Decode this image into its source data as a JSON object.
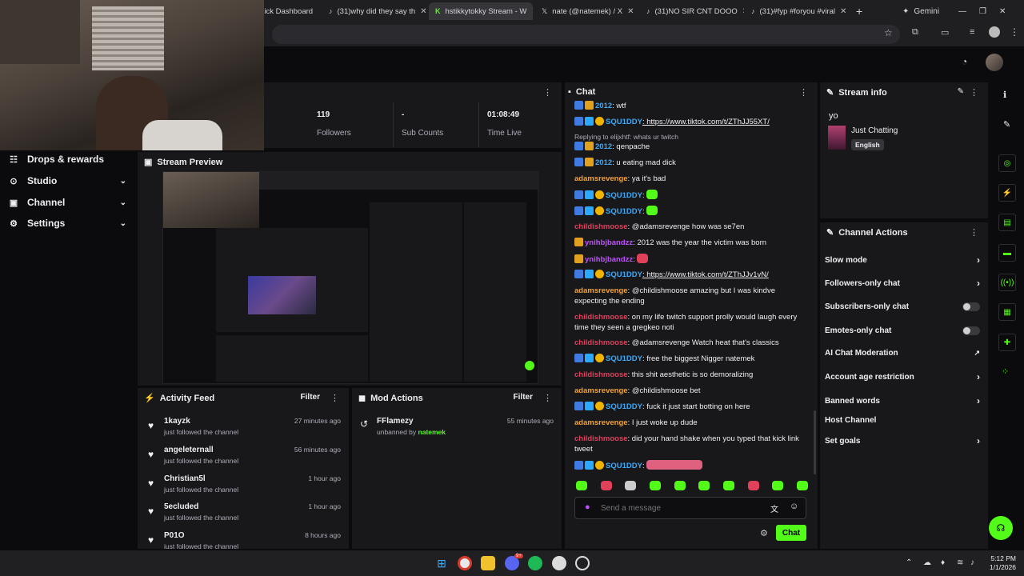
{
  "browser": {
    "tabs": [
      {
        "label": "Kick Dashboard",
        "icon": "kick-icon"
      },
      {
        "label": "(31)why did they say th",
        "icon": "tiktok-icon"
      },
      {
        "label": "hstikkytokky Stream - W",
        "icon": "kick-icon"
      },
      {
        "label": "nate (@natemek) / X",
        "icon": "x-icon"
      },
      {
        "label": "(31)NO SIR CNT DOOO",
        "icon": "tiktok-icon"
      },
      {
        "label": "(31)#fyp #foryou #viral",
        "icon": "tiktok-icon"
      }
    ],
    "gemini_label": "Gemini"
  },
  "sidebar": {
    "items": [
      {
        "label": "Drops & rewards",
        "icon": "rewards-icon"
      },
      {
        "label": "Studio",
        "icon": "studio-icon"
      },
      {
        "label": "Channel",
        "icon": "channel-icon"
      },
      {
        "label": "Settings",
        "icon": "gear-icon"
      }
    ]
  },
  "stats": {
    "followers": {
      "value": "119",
      "label": "Followers"
    },
    "subs": {
      "value": "-",
      "label": "Sub Counts"
    },
    "time": {
      "value": "01:08:49",
      "label": "Time Live"
    }
  },
  "preview": {
    "title": "Stream Preview"
  },
  "activity": {
    "title": "Activity Feed",
    "filter": "Filter",
    "items": [
      {
        "name": "1kayzk",
        "sub": "just followed the channel",
        "time": "27 minutes ago"
      },
      {
        "name": "angeleternall",
        "sub": "just followed the channel",
        "time": "56 minutes ago"
      },
      {
        "name": "Christian5l",
        "sub": "just followed the channel",
        "time": "1 hour ago"
      },
      {
        "name": "5ecluded",
        "sub": "just followed the channel",
        "time": "1 hour ago"
      },
      {
        "name": "P01O",
        "sub": "just followed the channel",
        "time": "8 hours ago"
      }
    ]
  },
  "mod": {
    "title": "Mod Actions",
    "filter": "Filter",
    "items": [
      {
        "name": "FFlamezy",
        "action": "unbanned by",
        "by": "natemek",
        "time": "55 minutes ago"
      }
    ]
  },
  "chat": {
    "title": "Chat",
    "placeholder": "Send a message",
    "send": "Chat",
    "messages": [
      {
        "user": "2012",
        "text": ": wtf"
      },
      {
        "user": "SQU1DDY",
        "text": ": https://www.tiktok.com/t/ZThJJ55XT/"
      },
      {
        "reply": "Replying to elijxhtf: whats ur twitch",
        "user": "2012",
        "text": ": qenpache"
      },
      {
        "user": "2012",
        "text": ": u eating mad dick"
      },
      {
        "user": "adamsrevenge",
        "text": ": ya it's bad"
      },
      {
        "user": "SQU1DDY",
        "text": ":"
      },
      {
        "user": "SQU1DDY",
        "text": ":"
      },
      {
        "user": "childishmoose",
        "text": ": @adamsrevenge how was se7en"
      },
      {
        "user": "ynihbjbandzz",
        "text": ": 2012 was the year the victim was born"
      },
      {
        "user": "ynihbjbandzz",
        "text": ":"
      },
      {
        "user": "SQU1DDY",
        "text": ": https://www.tiktok.com/t/ZThJJv1vN/"
      },
      {
        "user": "adamsrevenge",
        "text": ": @childishmoose amazing but I was kindve expecting the ending"
      },
      {
        "user": "childishmoose",
        "text": ": on my life twitch support prolly would laugh every time they seen a gregkeo noti"
      },
      {
        "user": "childishmoose",
        "text": ": @adamsrevenge Watch heat that's classics"
      },
      {
        "user": "SQU1DDY",
        "text": ": free the biggest Nigger natemek"
      },
      {
        "user": "childishmoose",
        "text": ": this shit aesthetic is so demoralizing"
      },
      {
        "user": "adamsrevenge",
        "text": ": @childishmoose bet"
      },
      {
        "user": "SQU1DDY",
        "text": ": fuck it just start botting on here"
      },
      {
        "user": "adamsrevenge",
        "text": ": I just woke up dude"
      },
      {
        "user": "childishmoose",
        "text": ": did your hand shake when you typed that kick link tweet"
      },
      {
        "user": "SQU1DDY",
        "text": ":"
      }
    ]
  },
  "stream_info": {
    "title": "Stream info",
    "stream_title": "yo",
    "category": "Just Chatting",
    "language": "English"
  },
  "channel_actions": {
    "title": "Channel Actions",
    "items": [
      {
        "label": "Slow mode",
        "control": "arrow"
      },
      {
        "label": "Followers-only chat",
        "control": "arrow"
      },
      {
        "label": "Subscribers-only chat",
        "control": "toggle"
      },
      {
        "label": "Emotes-only chat",
        "control": "toggle"
      },
      {
        "label": "AI Chat Moderation",
        "control": "external"
      },
      {
        "label": "Account age restriction",
        "control": "arrow"
      },
      {
        "label": "Banned words",
        "control": "arrow"
      },
      {
        "label": "Host Channel",
        "control": "none"
      },
      {
        "label": "Set goals",
        "control": "arrow"
      }
    ]
  },
  "taskbar": {
    "time": "5:12 PM",
    "date": "1/1/2026",
    "discord_badge": "9+"
  },
  "colors": {
    "accent": "#53fc18",
    "panel": "#18181b",
    "bg": "#0b0b0d"
  }
}
